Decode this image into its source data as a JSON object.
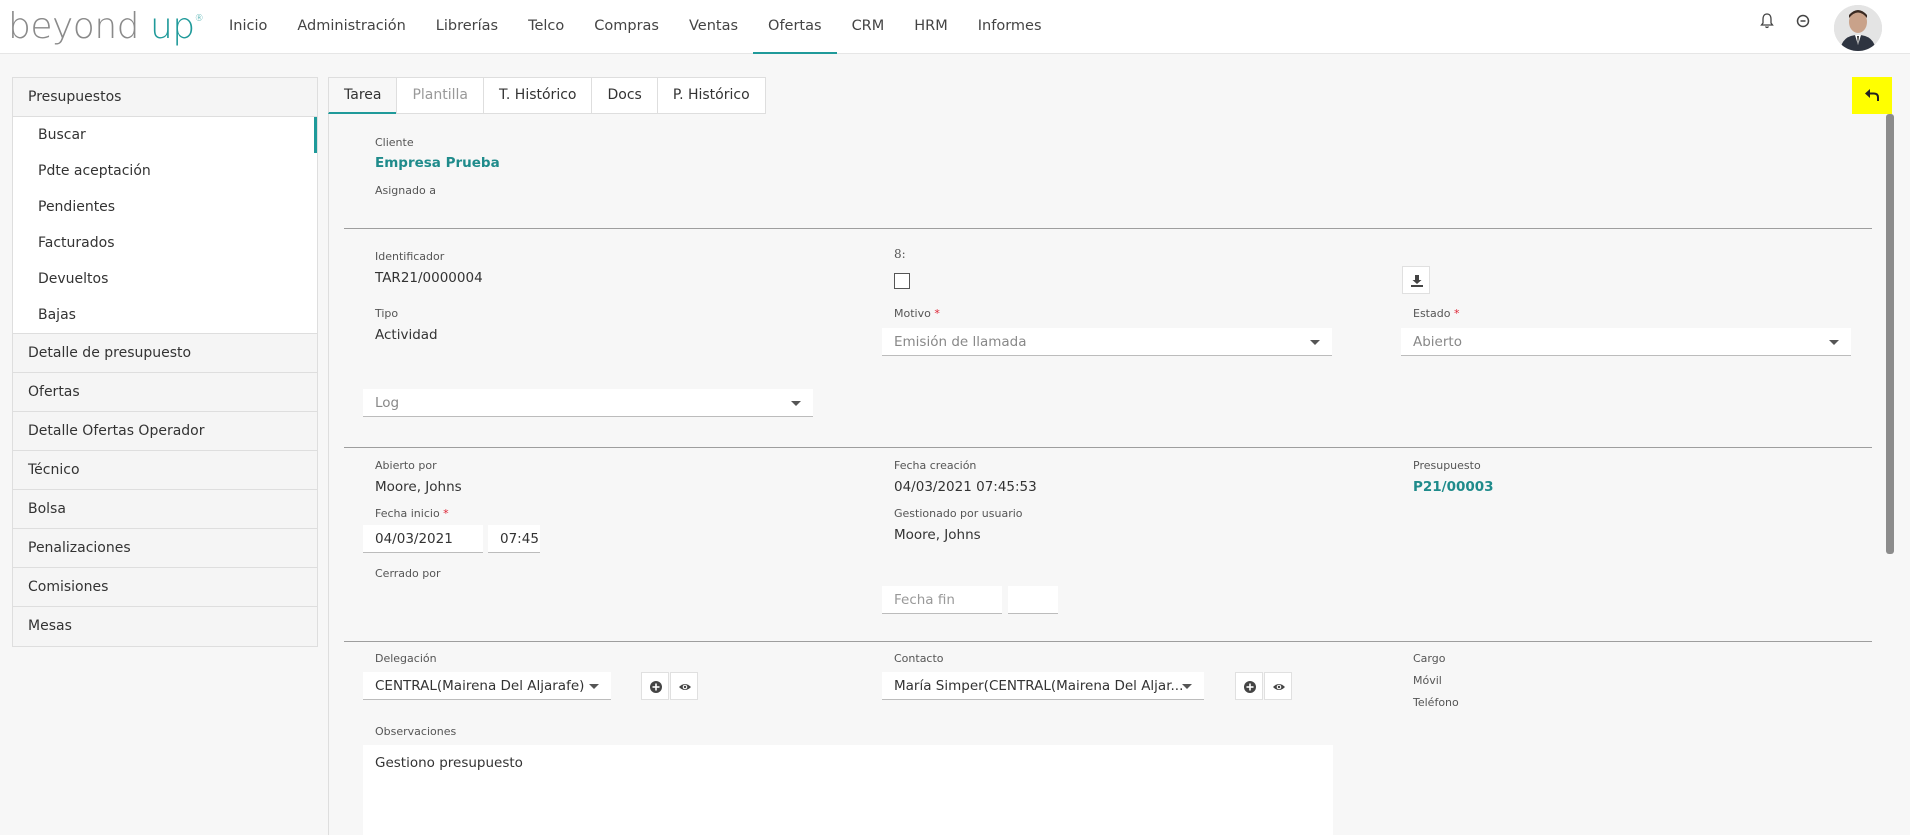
{
  "brand": {
    "part1": "beyond",
    "part2": "up",
    "mark": "®"
  },
  "nav": {
    "items": [
      "Inicio",
      "Administración",
      "Librerías",
      "Telco",
      "Compras",
      "Ventas",
      "Ofertas",
      "CRM",
      "HRM",
      "Informes"
    ],
    "active": "Ofertas"
  },
  "sidebar": {
    "group_presupuestos": "Presupuestos",
    "sub": [
      "Buscar",
      "Pdte aceptación",
      "Pendientes",
      "Facturados",
      "Devueltos",
      "Bajas"
    ],
    "groups": [
      "Detalle de presupuesto",
      "Ofertas",
      "Detalle Ofertas Operador",
      "Técnico",
      "Bolsa",
      "Penalizaciones",
      "Comisiones",
      "Mesas"
    ]
  },
  "tabs": [
    "Tarea",
    "Plantilla",
    "T. Histórico",
    "Docs",
    "P. Histórico"
  ],
  "form": {
    "cliente_label": "Cliente",
    "cliente_value": "Empresa Prueba",
    "asignado_label": "Asignado a",
    "identificador_label": "Identificador",
    "identificador_value": "TAR21/0000004",
    "s_label": "8:",
    "tipo_label": "Tipo",
    "tipo_value": "Actividad",
    "motivo_label": "Motivo",
    "motivo_value": "Emisión de llamada",
    "estado_label": "Estado",
    "estado_value": "Abierto",
    "log_value": "Log",
    "abierto_por_label": "Abierto por",
    "abierto_por_value": "Moore, Johns",
    "fecha_creacion_label": "Fecha creación",
    "fecha_creacion_value": "04/03/2021 07:45:53",
    "presupuesto_label": "Presupuesto",
    "presupuesto_value": "P21/00003",
    "fecha_inicio_label": "Fecha inicio",
    "fecha_inicio_date": "04/03/2021",
    "fecha_inicio_time": "07:45",
    "gestionado_label": "Gestionado por usuario",
    "gestionado_value": "Moore, Johns",
    "cerrado_label": "Cerrado por",
    "fecha_fin_placeholder": "Fecha fin",
    "delegacion_label": "Delegación",
    "delegacion_value": "CENTRAL(Mairena Del Aljarafe)",
    "contacto_label": "Contacto",
    "contacto_value": "María Simper(CENTRAL(Mairena Del Aljar...",
    "cargo_label": "Cargo",
    "movil_label": "Móvil",
    "telefono_label": "Teléfono",
    "observaciones_label": "Observaciones",
    "observaciones_value": "Gestiono presupuesto",
    "required_mark": "*"
  },
  "colors": {
    "accent": "#1f9a9a",
    "highlight": "#ffff00"
  },
  "icons": [
    "bell-icon",
    "power-icon",
    "back-arrow-icon",
    "download-icon",
    "add-circle-icon",
    "eye-icon",
    "chevron-down-icon"
  ]
}
